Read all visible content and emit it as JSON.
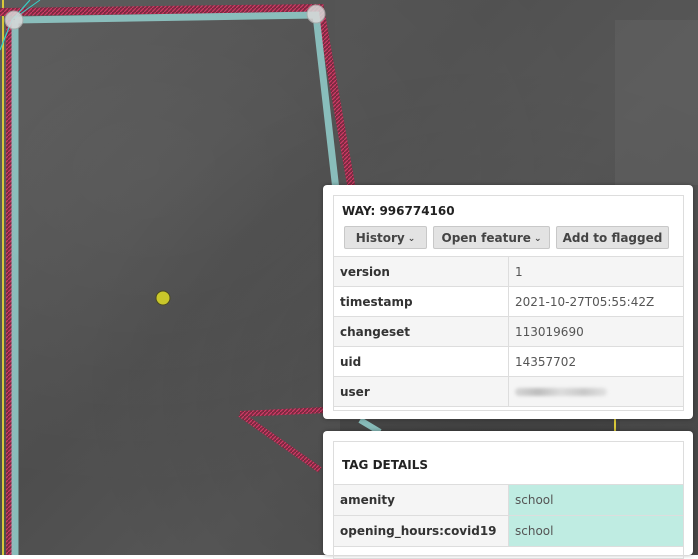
{
  "map": {
    "way_outline_color": "#8fc9c6",
    "way_casing_color": "#c0305a",
    "node_color": "#c9c72a",
    "road_color": "#d8c83a"
  },
  "way_panel": {
    "title": "WAY: 996774160",
    "buttons": {
      "history": "History",
      "open_feature": "Open feature",
      "add_to_flagged": "Add to flagged"
    },
    "dropdown_icon": "chevron-down-icon",
    "properties": [
      {
        "key": "version",
        "value": "1"
      },
      {
        "key": "timestamp",
        "value": "2021-10-27T05:55:42Z"
      },
      {
        "key": "changeset",
        "value": "113019690"
      },
      {
        "key": "uid",
        "value": "14357702"
      },
      {
        "key": "user",
        "value": ""
      }
    ]
  },
  "tag_panel": {
    "title": "TAG DETAILS",
    "highlight_color": "#bfece2",
    "tags": [
      {
        "key": "amenity",
        "value": "school"
      },
      {
        "key": "opening_hours:covid19",
        "value": "school"
      }
    ]
  }
}
